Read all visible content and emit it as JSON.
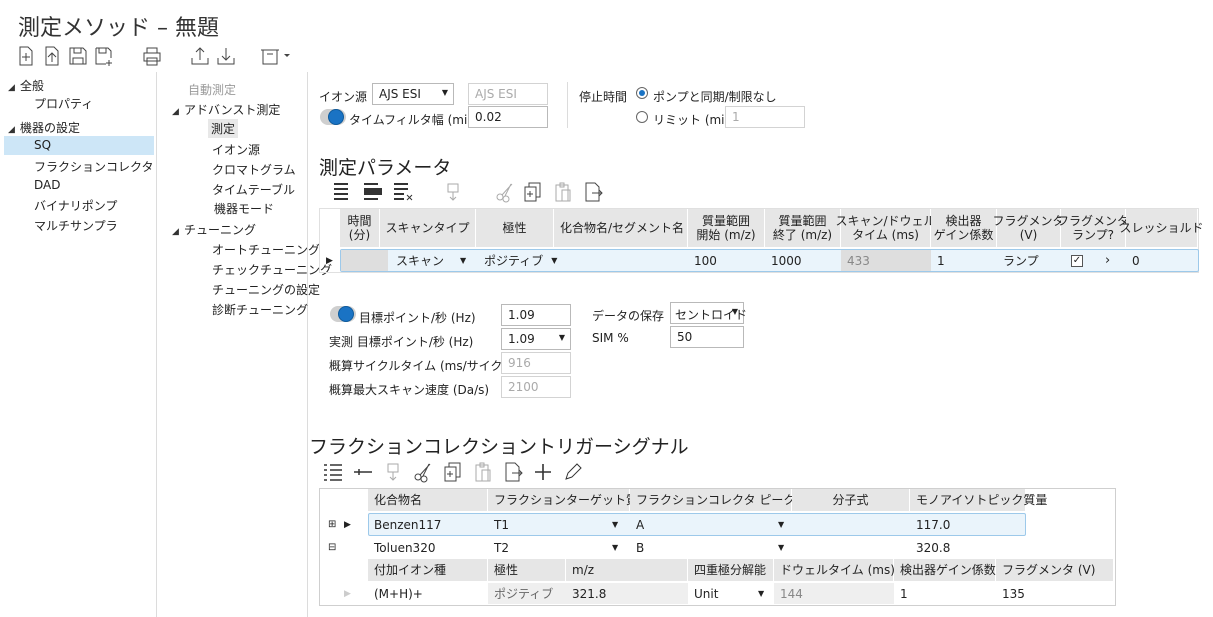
{
  "window": {
    "title": "測定メソッド – 無題"
  },
  "nav": {
    "groups": [
      {
        "label": "全般",
        "items": [
          "プロパティ"
        ]
      },
      {
        "label": "機器の設定",
        "items": [
          "SQ",
          "フラクションコレクタ",
          "DAD",
          "バイナリポンプ",
          "マルチサンプラ"
        ]
      }
    ],
    "selected": "SQ"
  },
  "subnav": {
    "auto": "自動測定",
    "advanced": "アドバンスト測定",
    "advanced_items": [
      "測定",
      "イオン源",
      "クロマトグラム",
      "タイムテーブル",
      "機器モード"
    ],
    "tuning": "チューニング",
    "tuning_items": [
      "オートチューニング",
      "チェックチューニング",
      "チューニングの設定",
      "診断チューニング"
    ]
  },
  "ion": {
    "label": "イオン源",
    "value": "AJS ESI",
    "readonly": "AJS ESI",
    "filter_label": "タイムフィルタ幅 (min)",
    "filter_value": "0.02"
  },
  "stop": {
    "label": "停止時間",
    "opt1": "ポンプと同期/制限なし",
    "opt2": "リミット (min)",
    "limit_value": "1"
  },
  "params": {
    "title": "測定パラメータ",
    "headers": [
      "時間\n(分)",
      "スキャンタイプ",
      "極性",
      "化合物名/セグメント名",
      "質量範囲\n開始 (m/z)",
      "質量範囲\n終了 (m/z)",
      "スキャン/ドウェル\nタイム (ms)",
      "検出器\nゲイン係数",
      "フラグメンタ\n(V)",
      "フラグメンタ\nランプ?",
      "スレッショルド"
    ],
    "row": {
      "scan_type": "スキャン",
      "polarity": "ポジティブ",
      "compound": "",
      "mass_start": "100",
      "mass_end": "1000",
      "dwell": "433",
      "gain": "1",
      "fragmentor": "ランプ",
      "threshold": "0"
    }
  },
  "acq": {
    "target_label": "目標ポイント/秒 (Hz)",
    "target_value": "1.09",
    "actual_label": "実測 目標ポイント/秒 (Hz)",
    "actual_value": "1.09",
    "cycle_label": "概算サイクルタイム (ms/サイクル)",
    "cycle_value": "916",
    "scan_label": "概算最大スキャン速度 (Da/s)",
    "scan_value": "2100",
    "store_label": "データの保存",
    "store_value": "セントロイド",
    "sim_label": "SIM %",
    "sim_value": "50"
  },
  "trigger": {
    "title": "フラクションコレクショントリガーシグナル",
    "headers": [
      "化合物名",
      "フラクションターゲット質量列",
      "フラクションコレクタ ピークトリガー",
      "分子式",
      "モノアイソトピック質量"
    ],
    "rows": [
      {
        "name": "Benzen117",
        "target": "T1",
        "trigger": "A",
        "formula": "",
        "mass": "117.0"
      },
      {
        "name": "Toluen320",
        "target": "T2",
        "trigger": "B",
        "formula": "",
        "mass": "320.8"
      }
    ],
    "sub_headers": [
      "付加イオン種",
      "極性",
      "m/z",
      "四重極分解能",
      "ドウェルタイム (ms)",
      "検出器ゲイン係数",
      "フラグメンタ (V)"
    ],
    "sub_row": {
      "adduct": "(M+H)+",
      "polarity": "ポジティブ",
      "mz": "321.8",
      "resolution": "Unit",
      "dwell": "144",
      "gain": "1",
      "fragmentor": "135"
    }
  }
}
